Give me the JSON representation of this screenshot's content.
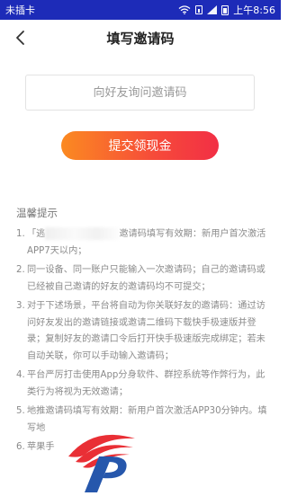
{
  "status_bar": {
    "carrier": "未插卡",
    "time": "上午8:56"
  },
  "header": {
    "title": "填写邀请码"
  },
  "form": {
    "placeholder": "向好友询问邀请码",
    "submit_label": "提交领现金"
  },
  "tips": {
    "title": "温馨提示",
    "items": [
      {
        "num": "1.",
        "before": "「逃",
        "after": "邀请码填写有效期：新用户首次激活APP7天以内；"
      },
      {
        "num": "2.",
        "text": "同一设备、同一账户只能输入一次邀请码；自己的邀请码或已经被自己邀请的好友的邀请码均不可提交；"
      },
      {
        "num": "3.",
        "text": "对于下述场景，平台将自动为你关联好友的邀请码：通过访问好友发出的邀请链接或邀请二维码下载快手极速版并登录；复制好友的邀请口令后打开快手极速版完成绑定；若未自动关联，你可以手动输入邀请码；"
      },
      {
        "num": "4.",
        "text": "平台严厉打击使用App分身软件、群控系统等作弊行为，此类行为将视为无效邀请；"
      },
      {
        "num": "5.",
        "text": "地推邀请码填写有效期：新用户首次激活APP30分钟内。填写地"
      },
      {
        "num": "6.",
        "text": "苹果手"
      }
    ]
  },
  "icons": {
    "back": "back-arrow-icon",
    "wifi": "wifi-icon",
    "sim": "sim-card-icon",
    "signal": "signal-icon",
    "battery": "battery-icon"
  },
  "colors": {
    "status_bar": "#1d2bb8",
    "button_start": "#fb8a21",
    "button_end": "#f22f45",
    "logo_red": "#e8242b",
    "logo_blue": "#1b4fa8"
  }
}
